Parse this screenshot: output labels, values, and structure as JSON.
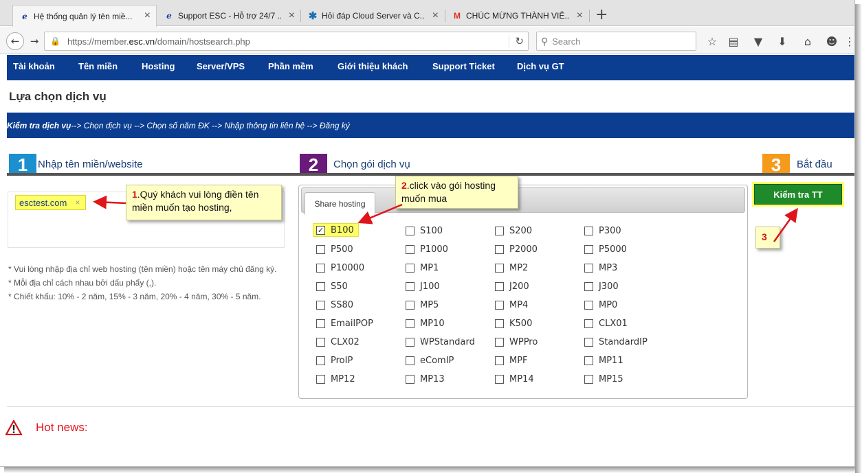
{
  "browser": {
    "tabs": [
      {
        "title": "Hệ thống quản lý tên miề...",
        "favicon": "e"
      },
      {
        "title": "Support ESC - Hỗ trợ 24/7 ...",
        "favicon": "e"
      },
      {
        "title": "Hỏi đáp Cloud Server và C...",
        "favicon": "star"
      },
      {
        "title": "CHÚC MỪNG THÀNH VIÊ...",
        "favicon": "M"
      }
    ],
    "url_prefix": "https://member.",
    "url_host": "esc.vn",
    "url_path": "/domain/hostsearch.php",
    "search_placeholder": "Search"
  },
  "nav": {
    "items": [
      "Tài khoản",
      "Tên miền",
      "Hosting",
      "Server/VPS",
      "Phần mềm",
      "Giới thiệu khách",
      "Support Ticket",
      "Dịch vụ GT"
    ]
  },
  "page": {
    "title": "Lựa chọn dịch vụ",
    "steps_current": "Kiểm tra dịch vụ",
    "steps_rest": " --> Chọn dịch vụ --> Chọn số năm ĐK --> Nhập thông tin liên hệ --> Đăng ký"
  },
  "step1": {
    "num": "1",
    "label": "Nhập tên miền/website",
    "color": "#1c8fce"
  },
  "step2": {
    "num": "2",
    "label": "Chọn gói dịch vụ",
    "color": "#6a1b7a"
  },
  "step3": {
    "num": "3",
    "label": "Bắt đầu",
    "color": "#f59a1b"
  },
  "domain": {
    "chip": "esctest.com",
    "remove": "×"
  },
  "notes": [
    "* Vui lòng nhập địa chỉ web hosting (tên miền) hoặc tên máy chủ đăng ký.",
    "* Mỗi địa chỉ cách nhau bởi dấu phẩy (,).",
    "* Chiết khấu: 10% - 2 năm, 15% - 3 năm, 20% - 4 năm, 30% - 5 năm."
  ],
  "callouts": {
    "c1_num": "1",
    "c1_text": ".Quý khách vui lòng điền tên",
    "c1_text2": "miền muốn tạo hosting,",
    "c2_num": "2",
    "c2_text": ".click vào gói hosting",
    "c2_text2": "muốn mua",
    "c3_num": "3"
  },
  "packages": {
    "tab": "Share hosting",
    "selected": "B100",
    "columns": [
      [
        "B100",
        "P500",
        "P10000",
        "S50",
        "SS80",
        "EmailPOP",
        "CLX02",
        "ProIP",
        "MP12"
      ],
      [
        "S100",
        "P1000",
        "MP1",
        "J100",
        "MP5",
        "MP10",
        "WPStandard",
        "eComIP",
        "MP13"
      ],
      [
        "S200",
        "P2000",
        "MP2",
        "J200",
        "MP4",
        "K500",
        "WPPro",
        "MPF",
        "MP14"
      ],
      [
        "P300",
        "P5000",
        "MP3",
        "J300",
        "MP0",
        "CLX01",
        "StandardIP",
        "MP11",
        "MP15"
      ]
    ]
  },
  "check_button": "Kiểm tra TT",
  "hot_news": "Hot news:"
}
